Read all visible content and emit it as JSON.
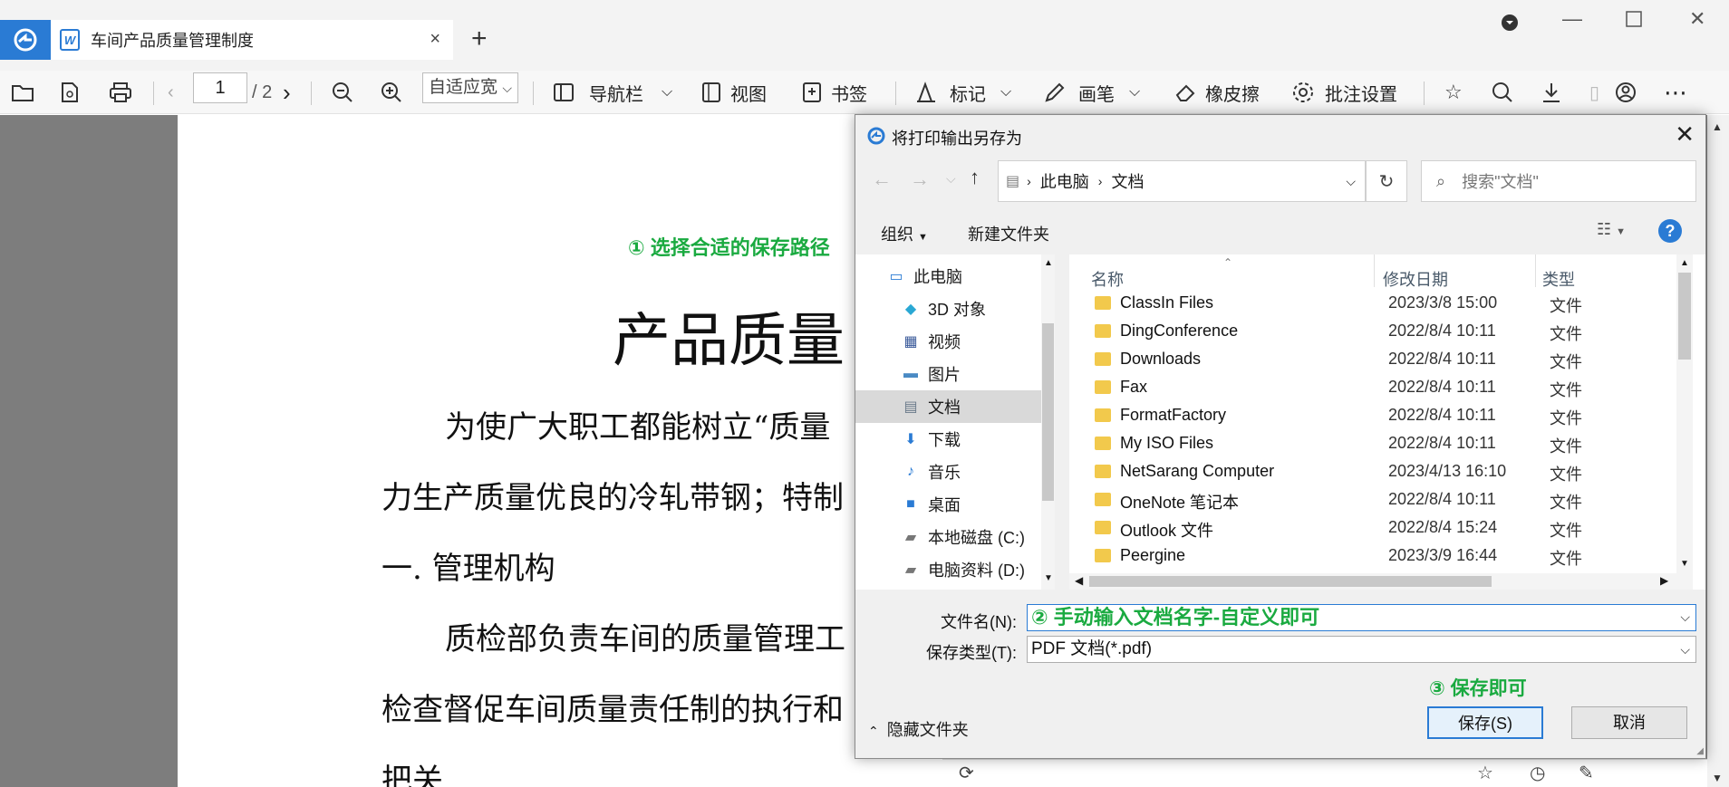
{
  "app": {
    "tab_title": "车间产品质量管理制度",
    "tab_icon_letter": "W",
    "new_tab": "+",
    "close_tab": "×"
  },
  "toolbar": {
    "page_current": "1",
    "page_total": "/ 2",
    "zoom": "自适应宽",
    "nav_pane": "导航栏",
    "view": "视图",
    "bookmark": "书签",
    "mark": "标记",
    "pen": "画笔",
    "eraser": "橡皮擦",
    "annotation_settings": "批注设置"
  },
  "document": {
    "lines": [
      "产品质量",
      "为使广大职工都能树立“质量",
      "力生产质量优良的冷轧带钢；特制",
      "一.   管理机构",
      "质检部负责车间的质量管理工",
      "检查督促车间质量责任制的执行和",
      "把关"
    ]
  },
  "annotations": {
    "step1": "① 选择合适的保存路径",
    "step2": "② 手动输入文档名字-自定义即可",
    "step3": "③ 保存即可"
  },
  "dialog": {
    "title": "将打印输出另存为",
    "breadcrumb": [
      "此电脑",
      "文档"
    ],
    "search_placeholder": "搜索\"文档\"",
    "organize": "组织",
    "new_folder": "新建文件夹",
    "nav_items": [
      {
        "label": "此电脑",
        "icon": "computer-icon"
      },
      {
        "label": "3D 对象",
        "icon": "cube-icon"
      },
      {
        "label": "视频",
        "icon": "video-icon"
      },
      {
        "label": "图片",
        "icon": "picture-icon"
      },
      {
        "label": "文档",
        "icon": "document-icon",
        "selected": true
      },
      {
        "label": "下载",
        "icon": "download-icon"
      },
      {
        "label": "音乐",
        "icon": "music-icon"
      },
      {
        "label": "桌面",
        "icon": "desktop-icon"
      },
      {
        "label": "本地磁盘 (C:)",
        "icon": "drive-icon"
      },
      {
        "label": "电脑资料 (D:)",
        "icon": "drive-icon"
      }
    ],
    "columns": {
      "name": "名称",
      "date": "修改日期",
      "type": "类型"
    },
    "files": [
      {
        "name": "ClassIn Files",
        "date": "2023/3/8 15:00",
        "type": "文件"
      },
      {
        "name": "DingConference",
        "date": "2022/8/4 10:11",
        "type": "文件"
      },
      {
        "name": "Downloads",
        "date": "2022/8/4 10:11",
        "type": "文件"
      },
      {
        "name": "Fax",
        "date": "2022/8/4 10:11",
        "type": "文件"
      },
      {
        "name": "FormatFactory",
        "date": "2022/8/4 10:11",
        "type": "文件"
      },
      {
        "name": "My ISO Files",
        "date": "2022/8/4 10:11",
        "type": "文件"
      },
      {
        "name": "NetSarang Computer",
        "date": "2023/4/13 16:10",
        "type": "文件"
      },
      {
        "name": "OneNote 笔记本",
        "date": "2022/8/4 10:11",
        "type": "文件"
      },
      {
        "name": "Outlook 文件",
        "date": "2022/8/4 15:24",
        "type": "文件"
      },
      {
        "name": "Peergine",
        "date": "2023/3/9 16:44",
        "type": "文件"
      }
    ],
    "filename_label": "文件名(N):",
    "filetype_label": "保存类型(T):",
    "filetype_value": "PDF 文档(*.pdf)",
    "hide_folders": "隐藏文件夹",
    "save": "保存(S)",
    "cancel": "取消"
  },
  "colors": {
    "accent": "#2a7bd4",
    "annotation_green": "#1aaa40",
    "folder_yellow": "#f2c94c",
    "doc_background": "#7d7d7d"
  }
}
